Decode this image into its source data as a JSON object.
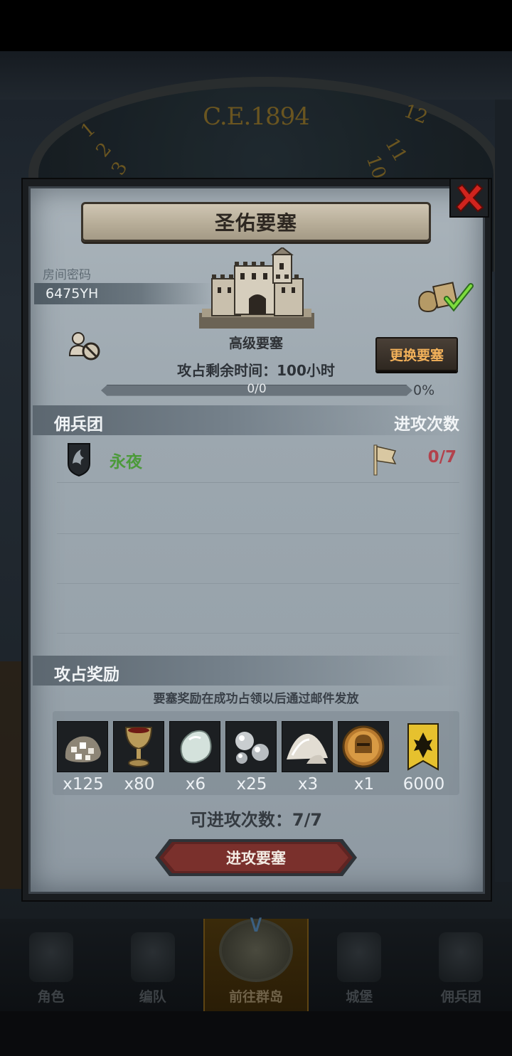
{
  "background": {
    "era_label": "C.E.1894",
    "dial_numbers": [
      "12",
      "1",
      "2",
      "3",
      "11",
      "10"
    ]
  },
  "modal": {
    "title": "圣佑要塞",
    "room_password_label": "房间密码",
    "room_code": "6475YH",
    "fortress_type": "高级要塞",
    "time_remaining": "攻占剩余时间：100小时",
    "change_fortress_label": "更换要塞",
    "progress": {
      "value_text": "0/0",
      "percent_text": "0%",
      "fraction": 0
    },
    "mercenary_section": {
      "title": "佣兵团",
      "attack_count_header": "进攻次数",
      "rows": [
        {
          "name": "永夜",
          "attack_count": "0/7"
        }
      ]
    },
    "rewards_section": {
      "title": "攻占奖励",
      "note": "要塞奖励在成功占领以后通过邮件发放",
      "items": [
        {
          "icon": "silver-ore-pile-icon",
          "qty": "x125"
        },
        {
          "icon": "goblet-icon",
          "qty": "x80"
        },
        {
          "icon": "pale-gem-icon",
          "qty": "x6"
        },
        {
          "icon": "silver-pearls-icon",
          "qty": "x25"
        },
        {
          "icon": "white-powder-icon",
          "qty": "x3"
        },
        {
          "icon": "knight-helmet-coin-icon",
          "qty": "x1"
        },
        {
          "icon": "guild-banner-icon",
          "qty": "6000"
        }
      ]
    },
    "attempts_remaining": "可进攻次数：7/7",
    "attack_button_label": "进攻要塞"
  },
  "bottom_nav": {
    "tabs": [
      {
        "label": "角色",
        "icon": "character-icon",
        "active": false
      },
      {
        "label": "编队",
        "icon": "formation-icon",
        "active": false
      },
      {
        "label": "前往群岛",
        "icon": "islands-icon",
        "active": true
      },
      {
        "label": "城堡",
        "icon": "castle-icon",
        "active": false
      },
      {
        "label": "佣兵团",
        "icon": "mercenary-icon",
        "active": false
      }
    ]
  },
  "colors": {
    "panel": "#9ca7af",
    "accent_orange": "#f2b15a",
    "merc_green": "#4c9a3a",
    "count_red": "#b2424c"
  }
}
